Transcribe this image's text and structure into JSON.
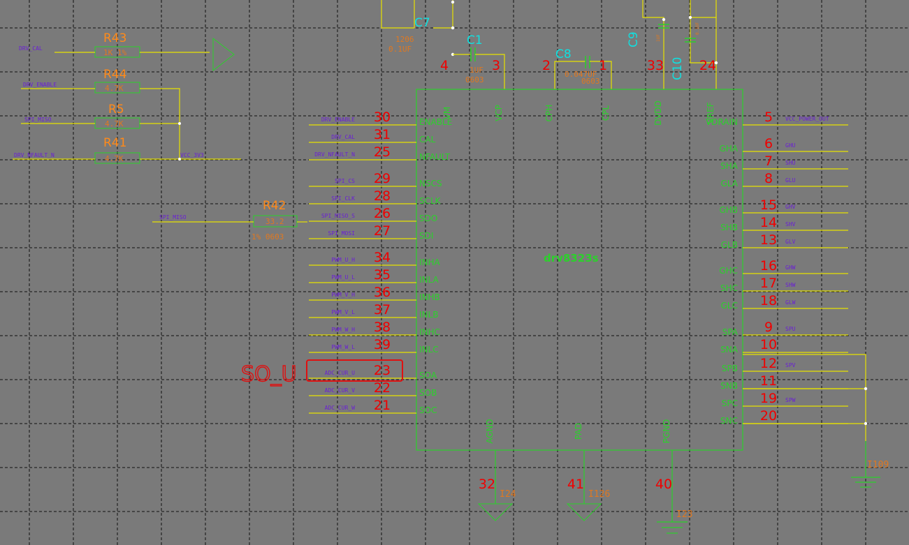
{
  "part_name": "drv8323s",
  "left_pins": [
    {
      "num": "30",
      "name": "ENABLE",
      "net": "DRV_ENABLE"
    },
    {
      "num": "31",
      "name": "CAL",
      "net": "DRV_CAL"
    },
    {
      "num": "25",
      "name": "NFAULT",
      "net": "DRV_NFAULT_N"
    },
    {
      "num": "29",
      "name": "NSCS",
      "net": "SPI_CS"
    },
    {
      "num": "28",
      "name": "SCLK",
      "net": "SPI_CLK"
    },
    {
      "num": "26",
      "name": "SDO",
      "net": "SPI_MISO_S"
    },
    {
      "num": "27",
      "name": "SDI",
      "net": "SPI_MOSI"
    },
    {
      "num": "34",
      "name": "INHA",
      "net": "PWM_U_H"
    },
    {
      "num": "35",
      "name": "INLA",
      "net": "PWM_U_L"
    },
    {
      "num": "36",
      "name": "INHB",
      "net": "PWM_V_H"
    },
    {
      "num": "37",
      "name": "INLB",
      "net": "PWM_V_L"
    },
    {
      "num": "38",
      "name": "INHC",
      "net": "PWM_W_H"
    },
    {
      "num": "39",
      "name": "INLC",
      "net": "PWM_W_L"
    },
    {
      "num": "23",
      "name": "SOA",
      "net": "ADC_CUR_U"
    },
    {
      "num": "22",
      "name": "SOB",
      "net": "ADC_CUR_V"
    },
    {
      "num": "21",
      "name": "SOC",
      "net": "ADC_CUR_W"
    }
  ],
  "right_pins": [
    {
      "num": "5",
      "name": "VDRAIN",
      "net": "VCC_POWER_OUT"
    },
    {
      "num": "6",
      "name": "GHA",
      "net": "GHU"
    },
    {
      "num": "7",
      "name": "SHA",
      "net": "SHU"
    },
    {
      "num": "8",
      "name": "GLA",
      "net": "GLU"
    },
    {
      "num": "15",
      "name": "GHB",
      "net": "GHV"
    },
    {
      "num": "14",
      "name": "SHB",
      "net": "SHV"
    },
    {
      "num": "13",
      "name": "GLB",
      "net": "GLV"
    },
    {
      "num": "16",
      "name": "GHC",
      "net": "GHW"
    },
    {
      "num": "17",
      "name": "SHC",
      "net": "SHW"
    },
    {
      "num": "18",
      "name": "GLC",
      "net": "GLW"
    },
    {
      "num": "9",
      "name": "SPA",
      "net": "SPU"
    },
    {
      "num": "10",
      "name": "SNA",
      "net": ""
    },
    {
      "num": "12",
      "name": "SPB",
      "net": "SPV"
    },
    {
      "num": "11",
      "name": "SNB",
      "net": ""
    },
    {
      "num": "19",
      "name": "SPC",
      "net": "SPW"
    },
    {
      "num": "20",
      "name": "SNC",
      "net": ""
    }
  ],
  "top_pins": [
    {
      "num": "4",
      "name": "VM"
    },
    {
      "num": "3",
      "name": "VCP"
    },
    {
      "num": "2",
      "name": "CPH"
    },
    {
      "num": "1",
      "name": "CPL"
    },
    {
      "num": "33",
      "name": "DVDD"
    },
    {
      "num": "24",
      "name": "VREF"
    }
  ],
  "bottom_pins": [
    {
      "num": "32",
      "name": "AGND",
      "gnd": "I24"
    },
    {
      "num": "41",
      "name": "PAD",
      "gnd": "I126"
    },
    {
      "num": "40",
      "name": "PGND",
      "gnd": "I23"
    }
  ],
  "capacitors": [
    {
      "ref": "C7",
      "value": "0.1UF",
      "pkg": "1206"
    },
    {
      "ref": "C1",
      "value": "1UF",
      "pkg": "0603"
    },
    {
      "ref": "C8",
      "value": "0.047UF",
      "pkg": "0603"
    },
    {
      "ref": "C9",
      "value": "1UF",
      "pkg": "0603"
    },
    {
      "ref": "C10",
      "value": "0.1UF",
      "pkg": "0603"
    }
  ],
  "resistors": [
    {
      "ref": "R43",
      "value": "1K 1%",
      "net": "DRV_CAL"
    },
    {
      "ref": "R44",
      "value": "4.7K",
      "net": "DRV_ENABLE"
    },
    {
      "ref": "R5",
      "value": "4.7K",
      "net": "SPI_MISO"
    },
    {
      "ref": "R41",
      "value": "4.7K",
      "net": "DRV_NFAULT_N"
    },
    {
      "ref": "R42",
      "value": "33.2",
      "net": "SPI_MISO",
      "extra": "1% 0603"
    }
  ],
  "vcc_net": "VCC_3V3",
  "ground_label_right": "I109",
  "annotation": "SO_U",
  "colors": {
    "wire": "#e8e200",
    "symbol": "#2bd12b",
    "pin_number": "#f00000",
    "net": "#6a1fd6",
    "ref": "#ff8a1a",
    "cap_ref": "#10e0e0",
    "annotation": "#e01010"
  }
}
